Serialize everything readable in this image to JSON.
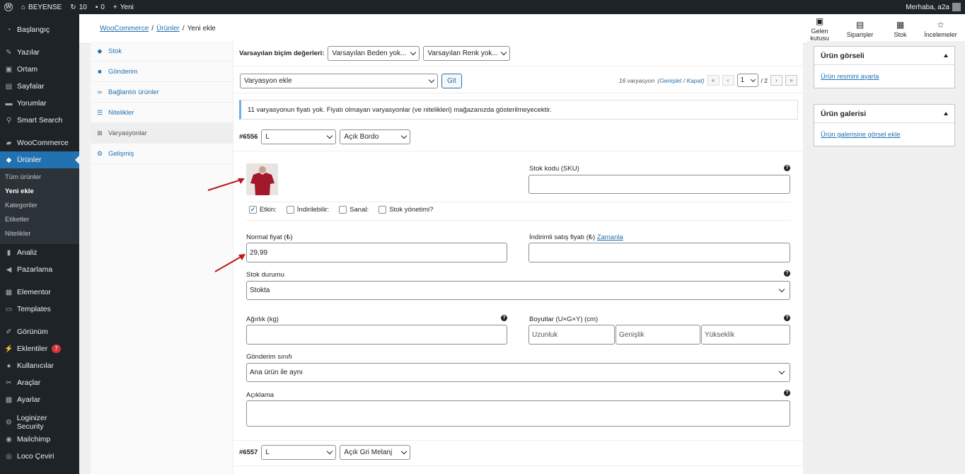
{
  "adminbar": {
    "site_name": "BEYENSE",
    "updates_count": "10",
    "comments_count": "0",
    "new_label": "Yeni",
    "greeting": "Merhaba, a2a"
  },
  "sidebar": {
    "items": [
      {
        "label": "Başlangıç",
        "icon": "dashboard-icon"
      },
      {
        "label": "Yazılar",
        "icon": "pin-icon"
      },
      {
        "label": "Ortam",
        "icon": "media-icon"
      },
      {
        "label": "Sayfalar",
        "icon": "pages-icon"
      },
      {
        "label": "Yorumlar",
        "icon": "comments-icon"
      },
      {
        "label": "Smart Search",
        "icon": "search-icon"
      },
      {
        "label": "WooCommerce",
        "icon": "woocommerce-icon"
      },
      {
        "label": "Ürünler",
        "icon": "products-icon"
      },
      {
        "label": "Analiz",
        "icon": "analytics-icon"
      },
      {
        "label": "Pazarlama",
        "icon": "megaphone-icon"
      },
      {
        "label": "Elementor",
        "icon": "elementor-icon"
      },
      {
        "label": "Templates",
        "icon": "folder-icon"
      },
      {
        "label": "Görünüm",
        "icon": "brush-icon"
      },
      {
        "label": "Eklentiler",
        "icon": "plugin-icon",
        "badge": "7"
      },
      {
        "label": "Kullanıcılar",
        "icon": "users-icon"
      },
      {
        "label": "Araçlar",
        "icon": "tools-icon"
      },
      {
        "label": "Ayarlar",
        "icon": "settings-icon"
      },
      {
        "label": "Loginizer Security",
        "icon": "gear-icon"
      },
      {
        "label": "Mailchimp",
        "icon": "mailchimp-icon"
      },
      {
        "label": "Loco Çeviri",
        "icon": "translate-icon"
      }
    ],
    "submenu": [
      "Tüm ürünler",
      "Yeni ekle",
      "Kategoriler",
      "Etiketler",
      "Nitelikler"
    ]
  },
  "header": {
    "breadcrumb": {
      "woocommerce": "WooCommerce",
      "products": "Ürünler",
      "current": "Yeni ekle",
      "sep": "/"
    },
    "actions": [
      {
        "label_line1": "Gelen",
        "label_line2": "kutusu",
        "icon": "inbox-icon"
      },
      {
        "label_line1": "Siparişler",
        "label_line2": "",
        "icon": "orders-icon"
      },
      {
        "label_line1": "Stok",
        "label_line2": "",
        "icon": "stock-icon"
      },
      {
        "label_line1": "İncelemeler",
        "label_line2": "",
        "icon": "star-icon"
      }
    ]
  },
  "tabs": [
    {
      "label": "Stok",
      "icon": "stock-tab-icon"
    },
    {
      "label": "Gönderim",
      "icon": "truck-icon"
    },
    {
      "label": "Bağlantılı ürünler",
      "icon": "link-icon"
    },
    {
      "label": "Nitelikler",
      "icon": "list-icon"
    },
    {
      "label": "Varyasyonlar",
      "icon": "grid-icon",
      "active": true
    },
    {
      "label": "Gelişmiş",
      "icon": "gear-icon"
    }
  ],
  "panel": {
    "defaults_label": "Varsayılan biçim değerleri:",
    "default_size": "Varsayılan Beden yok...",
    "default_color": "Varsayılan Renk yok...",
    "add_variation": "Varyasyon ekle",
    "go_button": "Git",
    "variation_count": "16 varyasyon",
    "expand": "Genişlet",
    "collapse": "Kapat",
    "page_current": "1",
    "page_total": "/ 2",
    "notice": "11 varyasyonun fiyatı yok. Fiyatı olmayan varyasyonlar (ve nitelikleri) mağazanızda gösterilmeyecektir.",
    "variation1": {
      "id": "#6556",
      "size": "L",
      "color": "Açık Bordo",
      "sku_label": "Stok kodu (SKU)",
      "checks": {
        "enabled": "Etkin:",
        "downloadable": "İndirilebilir:",
        "virtual": "Sanal:",
        "manage_stock": "Stok yönetimi?"
      },
      "price_label": "Normal fiyat (₺)",
      "price_value": "29,99",
      "sale_label": "İndirimli satış fiyatı (₺)",
      "schedule": "Zamanla",
      "stock_status_label": "Stok durumu",
      "stock_status": "Stokta",
      "weight_label": "Ağırlık (kg)",
      "dims_label": "Boyutlar (U×G×Y) (cm)",
      "length_ph": "Uzunluk",
      "width_ph": "Genişlik",
      "height_ph": "Yükseklik",
      "shipping_label": "Gönderim sınıfı",
      "shipping_value": "Ana ürün ile aynı",
      "desc_label": "Açıklama"
    },
    "variation2": {
      "id": "#6557",
      "size": "L",
      "color": "Açık Gri Melanj"
    }
  },
  "right": {
    "image_box_title": "Ürün görseli",
    "image_box_link": "Ürün resmini ayarla",
    "gallery_box_title": "Ürün galerisi",
    "gallery_box_link": "Ürün galerisine görsel ekle"
  },
  "colors": {
    "accent": "#2271b1",
    "admin_dark": "#1d2327",
    "annotation_arrow": "#c0161c",
    "shirt": "#a3182a"
  }
}
